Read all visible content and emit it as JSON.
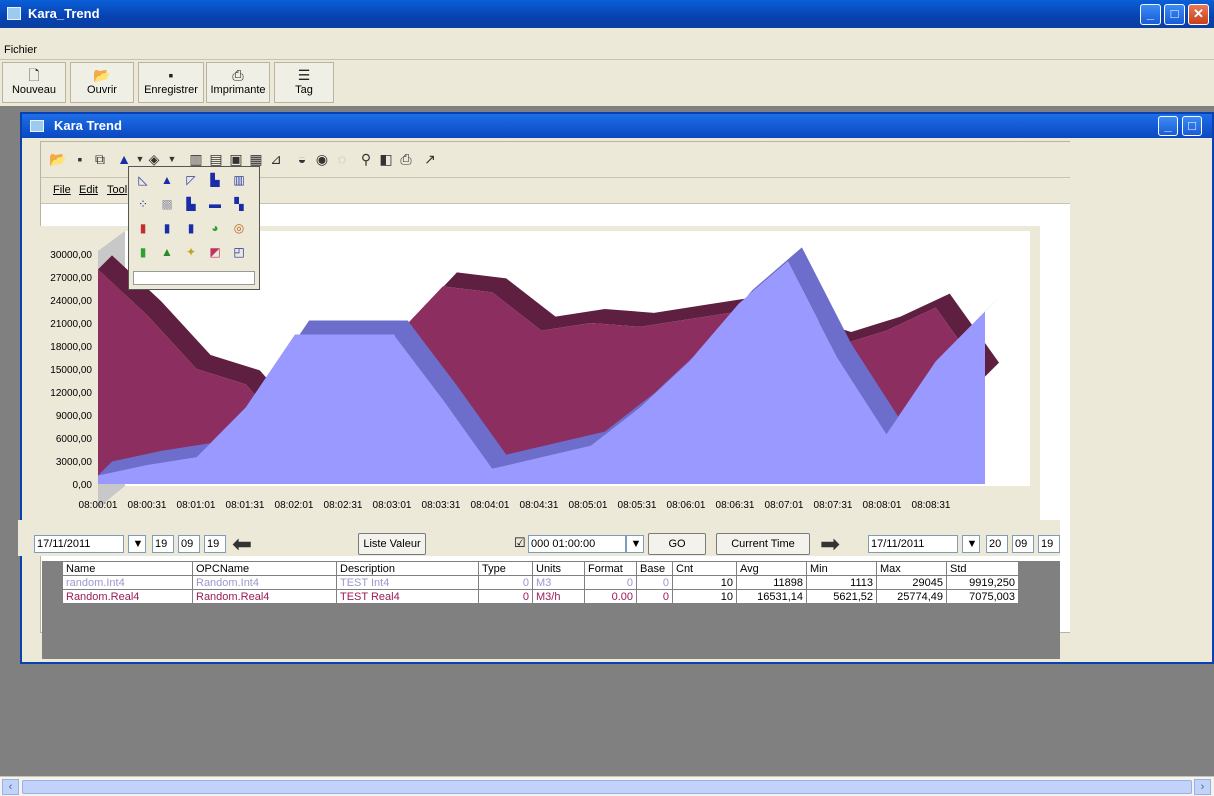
{
  "window": {
    "title": "Kara_Trend"
  },
  "menubar": {
    "items": [
      {
        "label": "Fichier"
      }
    ]
  },
  "toolbar": {
    "buttons": [
      {
        "label": "Nouveau",
        "icon": "new-file-icon"
      },
      {
        "label": "Ouvrir",
        "icon": "open-folder-icon"
      },
      {
        "label": "Enregistrer",
        "icon": "save-disk-icon"
      },
      {
        "label": "Imprimante",
        "icon": "printer-icon"
      },
      {
        "label": "Tag",
        "icon": "tag-icon"
      }
    ]
  },
  "child": {
    "title": "Kara Trend"
  },
  "chart_menu": {
    "items": [
      {
        "label": "File"
      },
      {
        "label": "Edit"
      },
      {
        "label": "Tool"
      }
    ]
  },
  "chart_data": {
    "type": "area",
    "categories": [
      "08:00:01",
      "08:00:31",
      "08:01:01",
      "08:01:31",
      "08:02:01",
      "08:02:31",
      "08:03:01",
      "08:03:31",
      "08:04:01",
      "08:04:31",
      "08:05:01",
      "08:05:31",
      "08:06:01",
      "08:06:31",
      "08:07:01",
      "08:07:31",
      "08:08:01",
      "08:08:31"
    ],
    "yticks": [
      "0,00",
      "3000,00",
      "6000,00",
      "9000,00",
      "12000,00",
      "15000,00",
      "18000,00",
      "21000,00",
      "24000,00",
      "27000,00",
      "30000,00"
    ],
    "ylim": [
      0,
      30000
    ],
    "series": [
      {
        "name": "random.Int4",
        "color": "#9999ff",
        "values": [
          1113,
          2500,
          3500,
          10000,
          19500,
          19500,
          19500,
          11000,
          2000,
          3500,
          5000,
          10000,
          16000,
          23500,
          29045,
          16500,
          6500,
          16000,
          22500
        ]
      },
      {
        "name": "Random.Real4",
        "color": "#8c2e5f",
        "values": [
          28000,
          22000,
          15000,
          13000,
          5621.52,
          12000,
          19000,
          25774.49,
          25000,
          20000,
          21000,
          20500,
          21500,
          22500,
          20000,
          18000,
          20000,
          23000,
          14000
        ]
      }
    ]
  },
  "controls": {
    "start_date": "17/11/2011",
    "start_h": "19",
    "start_m": "09",
    "start_s": "19",
    "liste_valeur": "Liste Valeur",
    "duration": "000 01:00:00",
    "go": "GO",
    "current_time": "Current Time",
    "end_date": "17/11/2011",
    "end_h": "20",
    "end_m": "09",
    "end_s": "19"
  },
  "table": {
    "headers": [
      "Name",
      "OPCName",
      "Description",
      "Type",
      "Units",
      "Format",
      "Base",
      "Cnt",
      "Avg",
      "Min",
      "Max",
      "Std"
    ],
    "rows": [
      {
        "color": "#9999cc",
        "cells": [
          "random.Int4",
          "Random.Int4",
          "TEST Int4",
          "0",
          "M3",
          "0",
          "0",
          "10",
          "11898",
          "1113",
          "29045",
          "9919,250"
        ]
      },
      {
        "color": "#9b1a5a",
        "cells": [
          "Random.Real4",
          "Random.Real4",
          "TEST Real4",
          "0",
          "M3/h",
          "0.00",
          "0",
          "10",
          "16531,14",
          "5621,52",
          "25774,49",
          "7075,003"
        ]
      }
    ]
  },
  "colors": {
    "accent": "#0842b0",
    "face": "#ece9d8"
  }
}
